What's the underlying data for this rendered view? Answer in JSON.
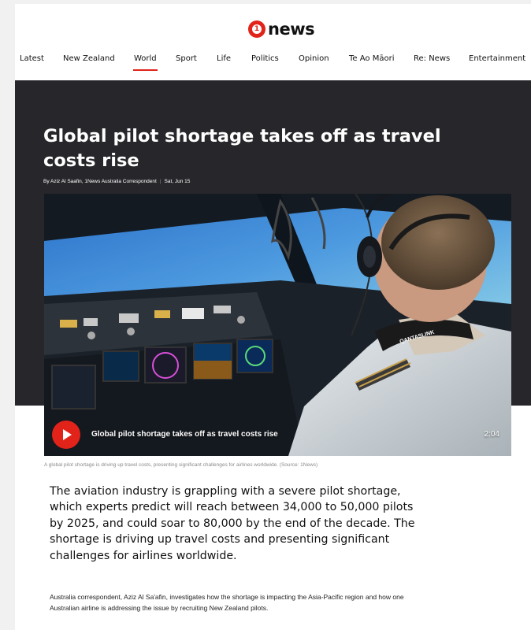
{
  "header": {
    "logo_badge": "1",
    "logo_text": "news"
  },
  "nav": {
    "items": [
      {
        "label": "Latest"
      },
      {
        "label": "New Zealand"
      },
      {
        "label": "World",
        "active": true
      },
      {
        "label": "Sport"
      },
      {
        "label": "Life"
      },
      {
        "label": "Politics"
      },
      {
        "label": "Opinion"
      },
      {
        "label": "Te Ao Māori"
      },
      {
        "label": "Re: News"
      },
      {
        "label": "Entertainment"
      }
    ]
  },
  "article": {
    "title": "Global pilot shortage takes off as travel costs rise",
    "byline": "By Aziz Al Saafin, 1News Australia Correspondent",
    "date": "Sat, Jun 15",
    "video": {
      "title": "Global pilot shortage takes off as travel costs rise",
      "duration": "2:04",
      "shoulder_text": "QANTASLINK"
    },
    "caption": "A global pilot shortage is driving up travel costs, presenting significant challenges for airlines worldwide. (Source: 1News)",
    "lead": "The aviation industry is grappling with a severe pilot shortage, which experts predict will reach between 34,000 to 50,000 pilots by 2025, and could soar to 80,000 by the end of the decade. The shortage is driving up travel costs and presenting significant challenges for airlines worldwide.",
    "body": "Australia correspondent, Aziz Al Sa'afin, investigates how the shortage is impacting the Asia-Pacific region and how one Australian airline is addressing the issue by recruiting New Zealand pilots."
  },
  "colors": {
    "brand_red": "#e2231a",
    "hero_bg": "#27272b"
  }
}
